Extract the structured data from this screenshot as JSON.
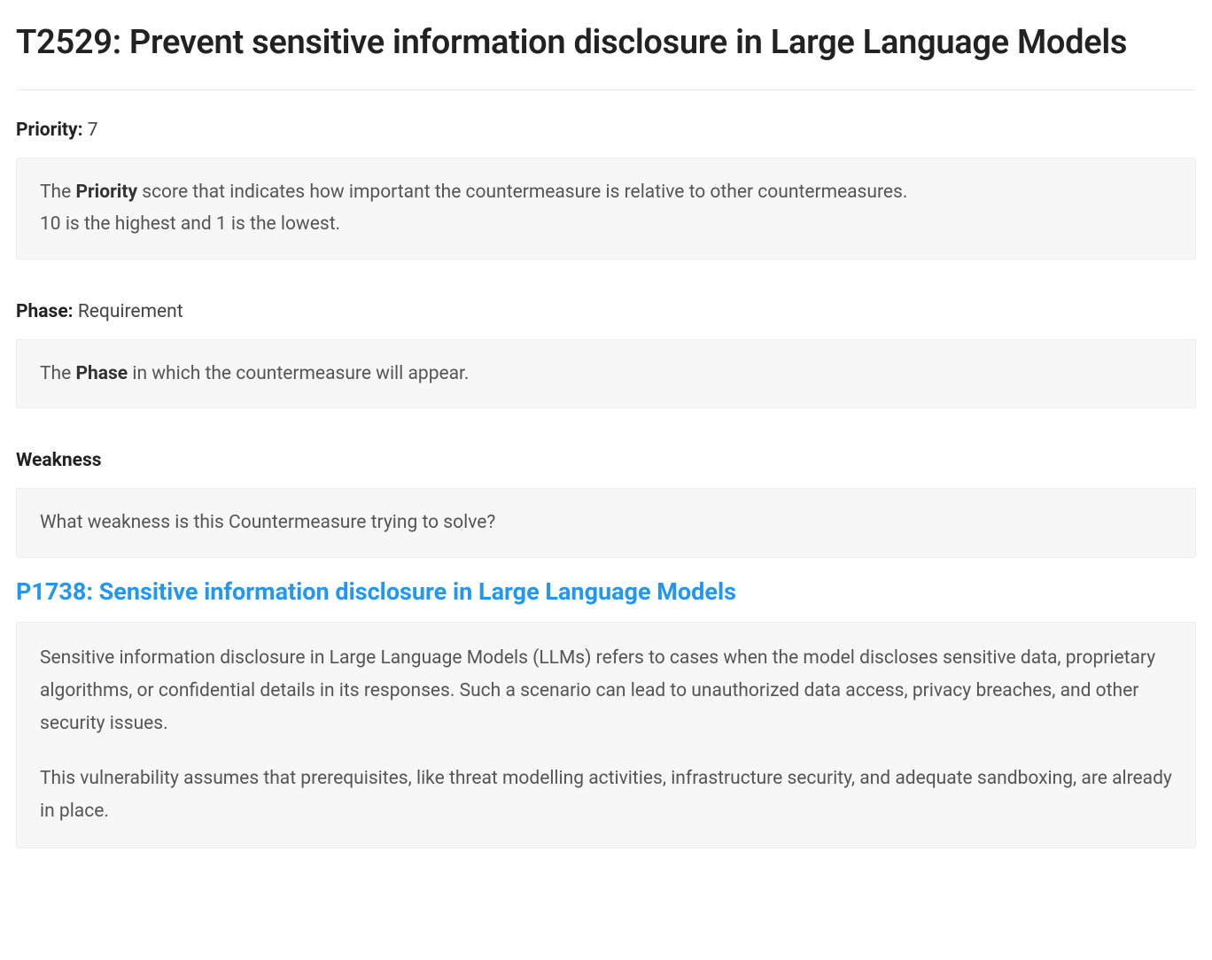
{
  "title": "T2529: Prevent sensitive information disclosure in Large Language Models",
  "priority": {
    "label": "Priority:",
    "value": "7",
    "desc_prefix": "The ",
    "desc_bold": "Priority",
    "desc_line1_suffix": " score that indicates how important the countermeasure is relative to other countermeasures.",
    "desc_line2": "10 is the highest and 1 is the lowest."
  },
  "phase": {
    "label": "Phase:",
    "value": "Requirement",
    "desc_prefix": "The ",
    "desc_bold": "Phase",
    "desc_suffix": " in which the countermeasure will appear."
  },
  "weakness": {
    "heading": "Weakness",
    "question": "What weakness is this Countermeasure trying to solve?",
    "link_text": "P1738: Sensitive information disclosure in Large Language Models",
    "para1": "Sensitive information disclosure in Large Language Models (LLMs) refers to cases when the model discloses sensitive data, proprietary algorithms, or confidential details in its responses. Such a scenario can lead to unauthorized data access, privacy breaches, and other security issues.",
    "para2": "This vulnerability assumes that prerequisites, like threat modelling activities, infrastructure security, and adequate sandboxing, are already in place."
  }
}
